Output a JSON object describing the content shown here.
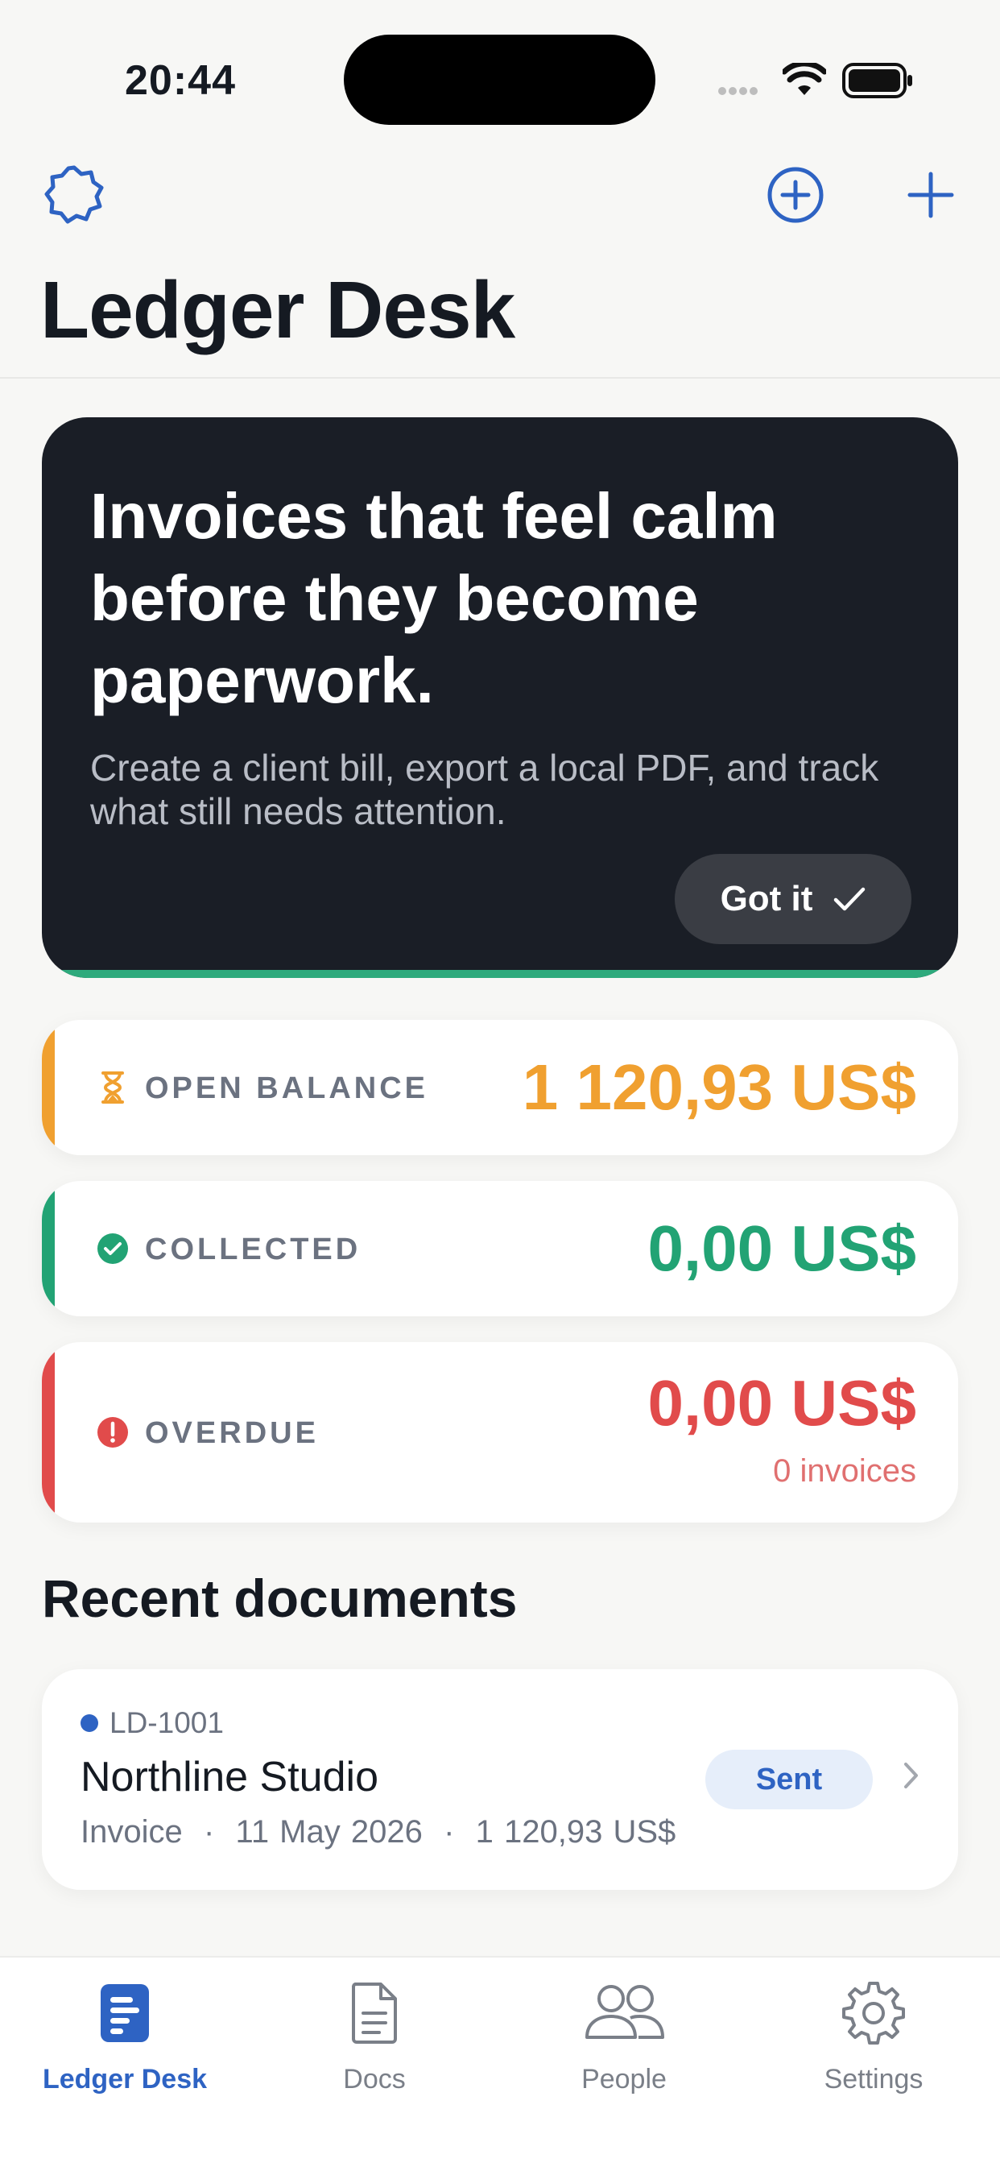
{
  "status_bar": {
    "time": "20:44"
  },
  "nav": {
    "title": "Ledger Desk"
  },
  "hero": {
    "title": "Invoices that feel calm before they become paperwork.",
    "subtitle": "Create a client bill, export a local PDF, and track what still needs attention.",
    "button_label": "Got it"
  },
  "stats": {
    "open_balance": {
      "label": "OPEN BALANCE",
      "value": "1 120,93 US$",
      "color": "#F0A030"
    },
    "collected": {
      "label": "COLLECTED",
      "value": "0,00 US$",
      "color": "#22A374"
    },
    "overdue": {
      "label": "OVERDUE",
      "value": "0,00 US$",
      "sub": "0 invoices",
      "color": "#E14B4B"
    }
  },
  "recent": {
    "title": "Recent documents",
    "items": [
      {
        "id": "LD-1001",
        "client": "Northline Studio",
        "type": "Invoice",
        "date": "11 May 2026",
        "amount": "1 120,93 US$",
        "status": "Sent"
      }
    ]
  },
  "tabs": [
    {
      "label": "Ledger Desk",
      "icon": "ledger-icon",
      "active": true
    },
    {
      "label": "Docs",
      "icon": "document-icon",
      "active": false
    },
    {
      "label": "People",
      "icon": "people-icon",
      "active": false
    },
    {
      "label": "Settings",
      "icon": "gear-icon",
      "active": false
    }
  ],
  "colors": {
    "accent": "#2E63C3",
    "hero_bg": "#1A1E26",
    "hero_accent": "#2EAA7C"
  }
}
